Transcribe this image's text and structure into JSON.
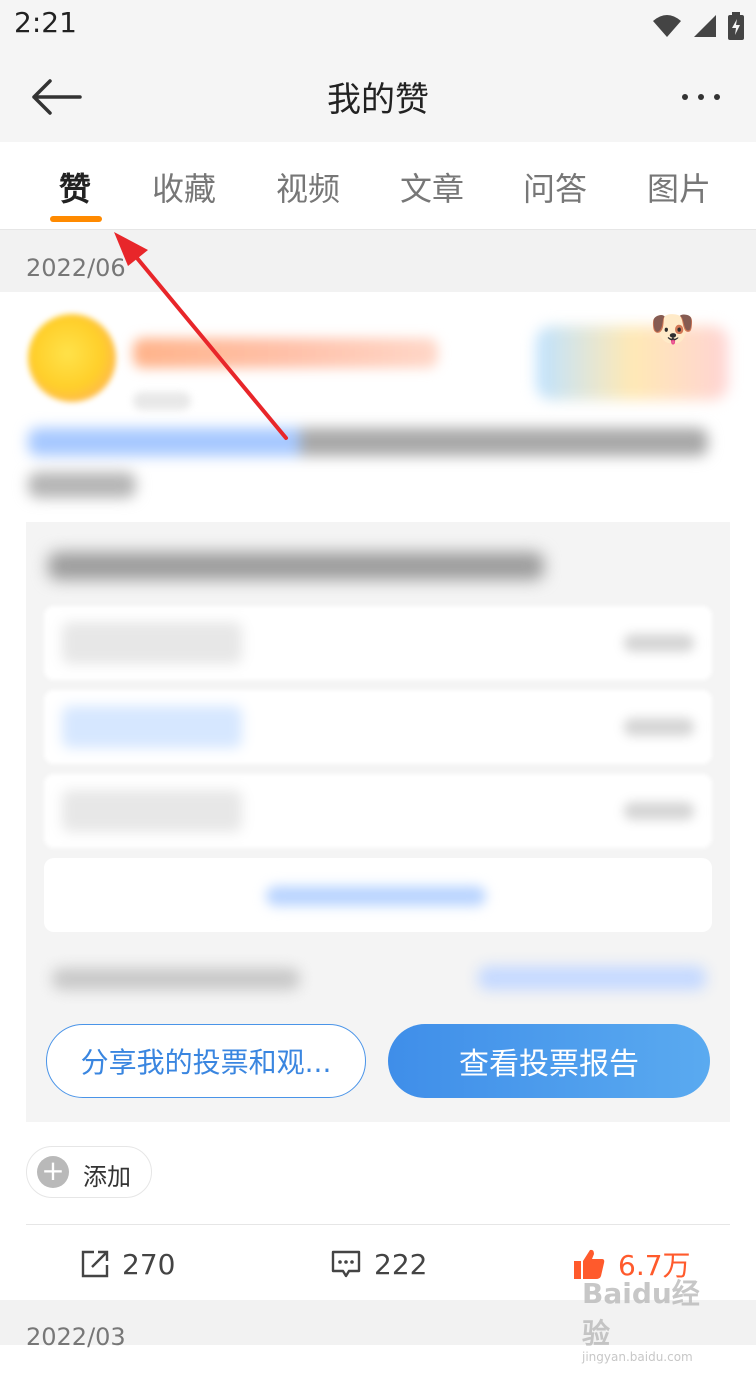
{
  "status_bar": {
    "time": "2:21"
  },
  "header": {
    "title": "我的赞"
  },
  "tabs": [
    {
      "label": "赞",
      "active": true
    },
    {
      "label": "收藏"
    },
    {
      "label": "视频"
    },
    {
      "label": "文章"
    },
    {
      "label": "问答"
    },
    {
      "label": "图片"
    }
  ],
  "sections": [
    {
      "date": "2022/06"
    },
    {
      "date": "2022/03"
    }
  ],
  "post": {
    "buttons": {
      "share": "分享我的投票和观...",
      "report": "查看投票报告",
      "add": "添加"
    },
    "stats": {
      "shares": "270",
      "comments": "222",
      "likes": "6.7万"
    }
  },
  "watermark": {
    "brand": "Baidu经验",
    "url": "jingyan.baidu.com"
  },
  "colors": {
    "accent": "#ff8a00",
    "like": "#ff5a2c",
    "primary_blue": "#3f8ee9"
  },
  "icons": [
    "back-arrow-icon",
    "more-dots-icon",
    "wifi-icon",
    "signal-icon",
    "battery-icon",
    "share-icon",
    "comment-icon",
    "thumb-up-icon",
    "plus-icon"
  ]
}
